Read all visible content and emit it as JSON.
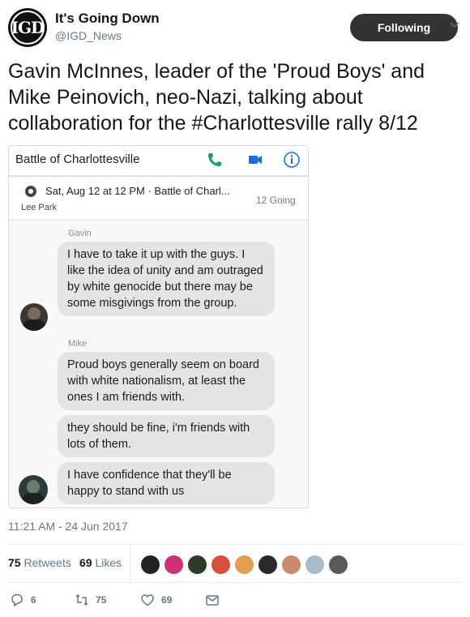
{
  "author": {
    "display_name": "It's Going Down",
    "handle": "@IGD_News",
    "logo_text": "IGD"
  },
  "follow_button": {
    "label": "Following"
  },
  "tweet": {
    "text_part1": "Gavin McInnes, leader of the 'Proud Boys' and Mike Peinovich, neo-Nazi, talking about collaboration for the ",
    "hashtag": "#Charlottesville",
    "text_part2": " rally 8/12"
  },
  "screenshot": {
    "chat_title": "Battle of Charlottesville",
    "event": {
      "datetime": "Sat, Aug 12 at 12 PM · Battle of Charl...",
      "place": "Lee Park",
      "going": "12 Going"
    },
    "messages": [
      {
        "sender": "Gavin",
        "text": "I have to take it up with the guys. I like the idea of unity and am outraged by white genocide but there may be some misgivings from the group."
      },
      {
        "sender": "Mike",
        "text": "Proud boys generally seem on board with white nationalism, at least the ones I am friends with."
      },
      {
        "sender": "",
        "text": "they should be fine, i'm friends with lots of them."
      },
      {
        "sender": "",
        "text": "I have confidence that they'll be happy to stand with us"
      }
    ]
  },
  "meta": {
    "timestamp": "11:21 AM - 24 Jun 2017"
  },
  "stats": {
    "retweets_count": "75",
    "retweets_label": "Retweets",
    "likes_count": "69",
    "likes_label": "Likes"
  },
  "liker_colors": [
    "#222222",
    "#d0307a",
    "#2e3a2a",
    "#d8503a",
    "#e0a050",
    "#2a2a2a",
    "#c88a6a",
    "#a8bcc8",
    "#5a5a5a"
  ],
  "actions": {
    "reply_count": "6",
    "retweet_count": "75",
    "like_count": "69"
  },
  "icons": [
    "chevron-down-icon",
    "phone-icon",
    "video-icon",
    "info-icon",
    "reply-icon",
    "retweet-icon",
    "heart-icon",
    "message-icon"
  ]
}
